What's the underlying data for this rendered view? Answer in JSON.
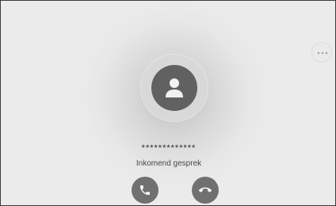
{
  "call": {
    "caller_number": "*************",
    "status": "Inkomend gesprek"
  },
  "icons": {
    "avatar": "person-icon",
    "more": "more-horizontal-icon",
    "accept": "phone-accept-icon",
    "decline": "phone-hangup-icon"
  },
  "colors": {
    "background": "#ebebeb",
    "avatar": "#616161",
    "buttons": "#707070"
  }
}
